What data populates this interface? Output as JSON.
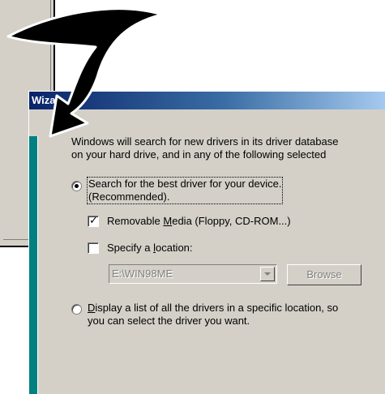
{
  "dialog": {
    "title_fragment": "Wiza",
    "intro_line1": "Windows will search for new drivers in its driver database",
    "intro_line2": "on your hard drive, and in any of the following selected"
  },
  "options": {
    "search_best": {
      "line1": "Search for the best driver for your device.",
      "line2": "(Recommended).",
      "selected": true
    },
    "removable_media": {
      "pre": "Removable ",
      "accel": "M",
      "post": "edia (Floppy, CD-ROM...)",
      "checked": true
    },
    "specify_location": {
      "pre": "Specify a ",
      "accel": "l",
      "post": "ocation:",
      "checked": false
    },
    "location_value": "E:\\WIN98ME",
    "browse_label": "Browse",
    "display_list": {
      "accel": "D",
      "line1_post": "isplay a list of all the drivers in a specific location, so",
      "line2": "you can select the driver you want.",
      "selected": false
    }
  },
  "colors": {
    "dialog_face": "#d4d0c8",
    "title_start": "#0a246a",
    "title_end": "#a6caf0",
    "side_panel": "#008080",
    "disabled_text": "#808080"
  }
}
